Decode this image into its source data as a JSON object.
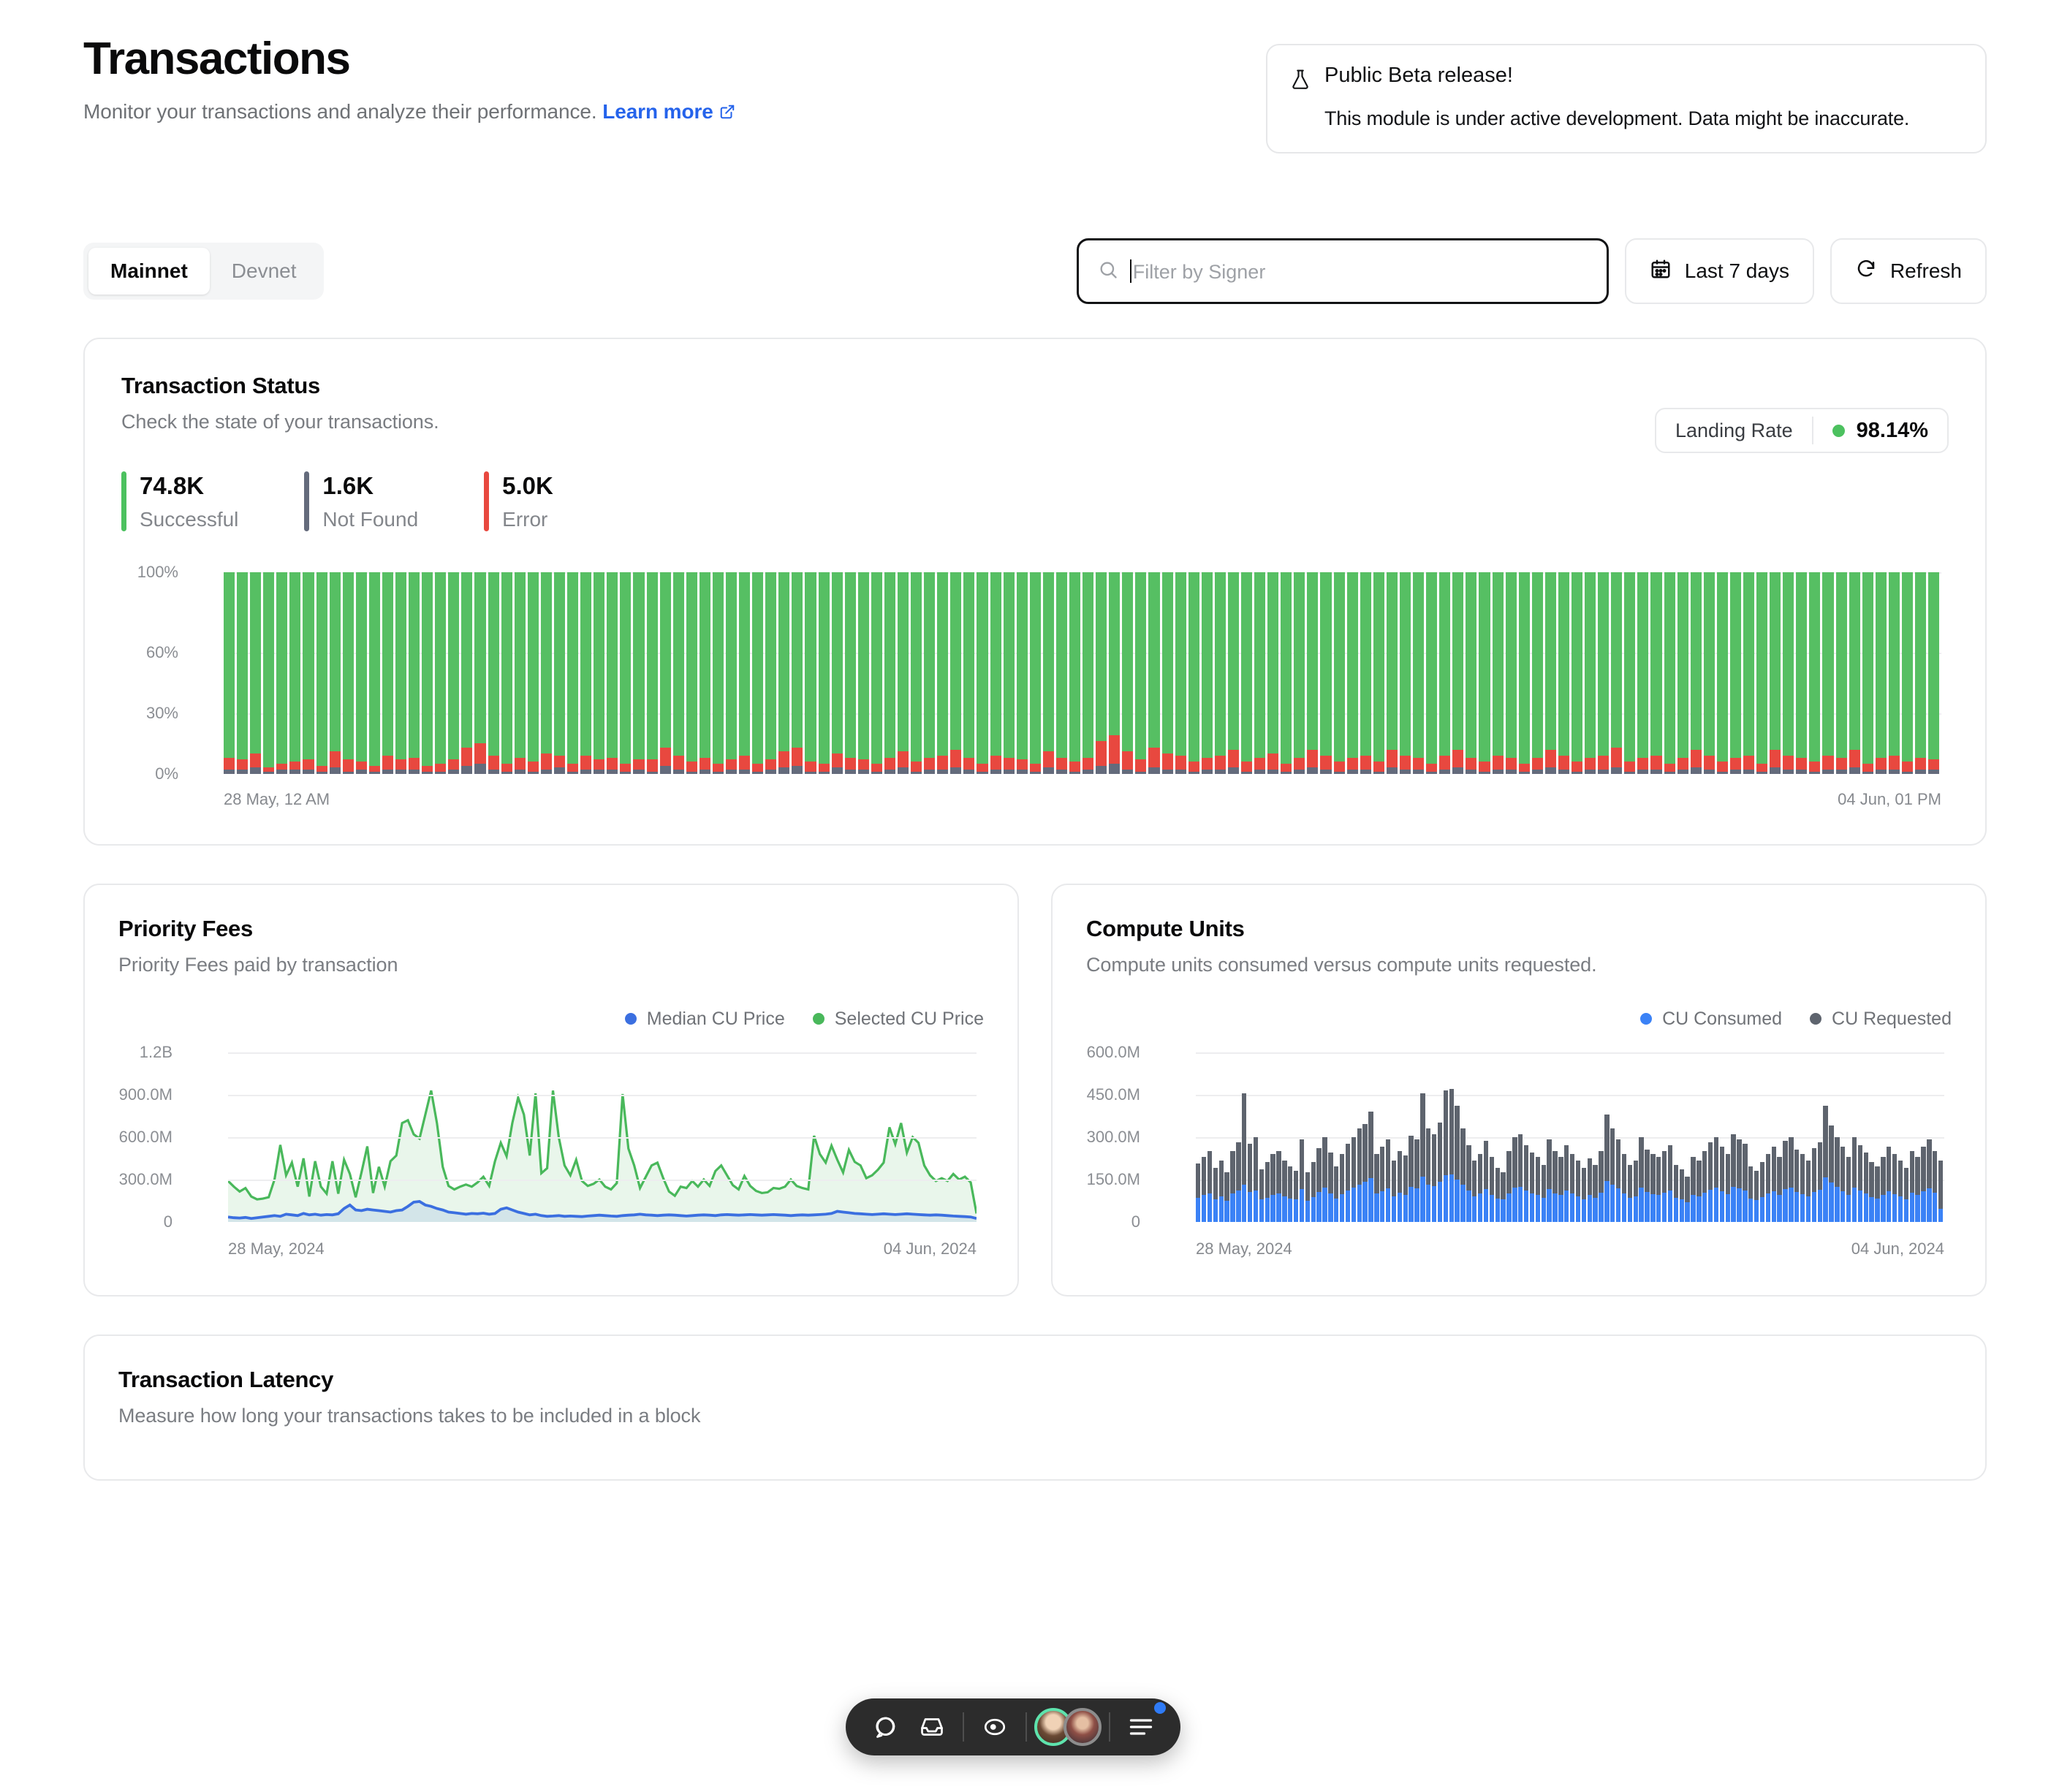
{
  "header": {
    "title": "Transactions",
    "subtitle": "Monitor your transactions and analyze their performance.",
    "learn_more": "Learn more",
    "learn_more_icon": "external-link-icon"
  },
  "beta_notice": {
    "icon": "flask-icon",
    "title": "Public Beta release!",
    "description": "This module is under active development. Data might be inaccurate."
  },
  "toolbar": {
    "network_tabs": [
      {
        "label": "Mainnet",
        "active": true
      },
      {
        "label": "Devnet",
        "active": false
      }
    ],
    "search": {
      "placeholder": "Filter by Signer",
      "value": "",
      "icon": "search-icon"
    },
    "date_range": {
      "label": "Last 7 days",
      "icon": "calendar-icon"
    },
    "refresh": {
      "label": "Refresh",
      "icon": "refresh-icon"
    }
  },
  "transaction_status": {
    "title": "Transaction Status",
    "subtitle": "Check the state of your transactions.",
    "stats": [
      {
        "value": "74.8K",
        "label": "Successful",
        "color": "#4cc15f"
      },
      {
        "value": "1.6K",
        "label": "Not Found",
        "color": "#646b7c"
      },
      {
        "value": "5.0K",
        "label": "Error",
        "color": "#e8483f"
      }
    ],
    "landing_rate": {
      "label": "Landing Rate",
      "value": "98.14%",
      "dot_color": "#4cc15f"
    }
  },
  "priority_fees": {
    "title": "Priority Fees",
    "subtitle": "Priority Fees paid by transaction",
    "legend": [
      {
        "label": "Median CU Price",
        "color": "#3b6fe0"
      },
      {
        "label": "Selected CU Price",
        "color": "#49b85b"
      }
    ]
  },
  "compute_units": {
    "title": "Compute Units",
    "subtitle": "Compute units consumed versus compute units requested.",
    "legend": [
      {
        "label": "CU Consumed",
        "color": "#3b82f6"
      },
      {
        "label": "CU Requested",
        "color": "#5e646e"
      }
    ]
  },
  "transaction_latency": {
    "title": "Transaction Latency",
    "subtitle": "Measure how long your transactions takes to be included in a block"
  },
  "floating_toolbar": {
    "items": [
      {
        "name": "comment-icon"
      },
      {
        "name": "inbox-icon"
      },
      {
        "name": "record-icon"
      },
      {
        "name": "avatar-1"
      },
      {
        "name": "avatar-2"
      },
      {
        "name": "menu-icon",
        "badge": true
      }
    ]
  },
  "chart_data": [
    {
      "id": "transaction_status_chart",
      "type": "bar",
      "stacked": true,
      "title": "Transaction Status",
      "xlabel": "",
      "ylabel": "",
      "ylim": [
        0,
        100
      ],
      "ytick_labels": [
        "100%",
        "60%",
        "30%",
        "0%"
      ],
      "ytick_values": [
        100,
        60,
        30,
        0
      ],
      "grid": true,
      "legend_position": "none",
      "x_axis_start": "28 May, 12 AM",
      "x_axis_end": "04 Jun, 01 PM",
      "series": [
        {
          "name": "Not Found",
          "color": "#646b7c",
          "values": [
            2,
            2,
            3,
            1,
            2,
            2,
            2,
            1,
            3,
            1,
            2,
            1,
            2,
            2,
            2,
            1,
            1,
            2,
            4,
            5,
            2,
            1,
            2,
            1,
            2,
            3,
            1,
            2,
            2,
            2,
            1,
            2,
            1,
            4,
            2,
            1,
            2,
            1,
            2,
            2,
            1,
            2,
            3,
            4,
            1,
            1,
            3,
            2,
            2,
            1,
            2,
            3,
            1,
            2,
            2,
            3,
            2,
            1,
            2,
            2,
            2,
            1,
            3,
            2,
            1,
            2,
            4,
            5,
            2,
            1,
            3,
            2,
            2,
            1,
            2,
            2,
            3,
            1,
            2,
            2,
            1,
            2,
            3,
            2,
            1,
            2,
            2,
            1,
            3,
            2,
            2,
            1,
            2,
            3,
            2,
            1,
            2,
            2,
            1,
            2,
            3,
            2,
            1,
            2,
            2,
            3,
            1,
            2,
            2,
            1,
            2,
            3,
            2,
            1,
            2,
            2,
            1,
            3,
            2,
            2,
            1,
            2,
            2,
            3,
            1,
            2,
            2,
            1,
            2,
            2
          ]
        },
        {
          "name": "Error",
          "color": "#e8483f",
          "values": [
            6,
            5,
            7,
            2,
            3,
            4,
            5,
            3,
            8,
            6,
            4,
            3,
            7,
            5,
            6,
            3,
            4,
            5,
            9,
            10,
            7,
            4,
            6,
            5,
            8,
            6,
            4,
            7,
            5,
            6,
            4,
            5,
            6,
            9,
            7,
            5,
            6,
            4,
            5,
            7,
            4,
            5,
            8,
            9,
            5,
            4,
            7,
            6,
            5,
            4,
            6,
            8,
            5,
            6,
            7,
            9,
            6,
            4,
            7,
            6,
            5,
            4,
            8,
            6,
            5,
            6,
            12,
            14,
            9,
            6,
            10,
            8,
            7,
            5,
            6,
            7,
            9,
            5,
            6,
            8,
            4,
            6,
            9,
            7,
            5,
            6,
            7,
            5,
            9,
            7,
            6,
            4,
            7,
            9,
            6,
            5,
            7,
            6,
            4,
            6,
            9,
            7,
            5,
            6,
            7,
            10,
            5,
            6,
            7,
            4,
            6,
            9,
            7,
            5,
            6,
            7,
            4,
            9,
            7,
            6,
            5,
            7,
            6,
            9,
            4,
            6,
            7,
            5,
            6,
            5
          ]
        },
        {
          "name": "Successful",
          "color": "#56bf63",
          "values": [
            92,
            93,
            90,
            97,
            95,
            94,
            93,
            96,
            89,
            93,
            94,
            96,
            91,
            93,
            92,
            96,
            95,
            93,
            87,
            85,
            91,
            95,
            92,
            94,
            90,
            91,
            95,
            91,
            93,
            92,
            95,
            93,
            93,
            87,
            91,
            94,
            92,
            95,
            93,
            91,
            95,
            93,
            89,
            87,
            94,
            95,
            90,
            92,
            93,
            95,
            92,
            89,
            94,
            92,
            91,
            88,
            92,
            95,
            91,
            92,
            93,
            95,
            89,
            92,
            94,
            92,
            84,
            81,
            89,
            93,
            87,
            90,
            91,
            94,
            92,
            91,
            88,
            94,
            92,
            90,
            95,
            92,
            88,
            91,
            94,
            92,
            91,
            94,
            88,
            91,
            92,
            95,
            91,
            88,
            92,
            94,
            91,
            92,
            95,
            92,
            88,
            91,
            94,
            92,
            91,
            87,
            94,
            92,
            91,
            95,
            92,
            88,
            91,
            94,
            92,
            91,
            95,
            88,
            91,
            92,
            94,
            91,
            92,
            88,
            95,
            92,
            91,
            94,
            92,
            93
          ]
        }
      ]
    },
    {
      "id": "priority_fees_chart",
      "type": "area",
      "title": "Priority Fees",
      "xlabel": "",
      "ylabel": "",
      "ylim": [
        0,
        1200000000
      ],
      "ytick_labels": [
        "1.2B",
        "900.0M",
        "600.0M",
        "300.0M",
        "0"
      ],
      "ytick_values": [
        1200000000,
        900000000,
        600000000,
        300000000,
        0
      ],
      "grid": true,
      "legend_position": "top-right",
      "x_axis_start": "28 May, 2024",
      "x_axis_end": "04 Jun, 2024",
      "series": [
        {
          "name": "Selected CU Price",
          "color": "#49b85b",
          "values": [
            290,
            250,
            215,
            240,
            180,
            160,
            165,
            175,
            300,
            545,
            330,
            420,
            250,
            450,
            180,
            430,
            250,
            200,
            430,
            200,
            440,
            340,
            175,
            350,
            535,
            205,
            390,
            250,
            430,
            470,
            700,
            720,
            620,
            590,
            760,
            930,
            700,
            390,
            255,
            230,
            250,
            265,
            250,
            280,
            320,
            255,
            430,
            560,
            465,
            700,
            880,
            760,
            470,
            910,
            345,
            380,
            930,
            600,
            400,
            330,
            440,
            290,
            255,
            270,
            300,
            250,
            230,
            275,
            905,
            520,
            400,
            240,
            320,
            400,
            420,
            310,
            215,
            185,
            250,
            240,
            290,
            250,
            300,
            255,
            360,
            400,
            330,
            260,
            230,
            325,
            255,
            220,
            205,
            210,
            240,
            235,
            250,
            300,
            255,
            240,
            230,
            610,
            480,
            420,
            540,
            440,
            350,
            510,
            425,
            400,
            310,
            330,
            370,
            420,
            670,
            550,
            700,
            490,
            600,
            560,
            400,
            330,
            290,
            310,
            290,
            340,
            300,
            320,
            280,
            60
          ]
        },
        {
          "name": "Median CU Price",
          "color": "#3b6fe0",
          "values": [
            35,
            30,
            28,
            32,
            25,
            30,
            35,
            40,
            45,
            40,
            55,
            50,
            45,
            60,
            50,
            55,
            48,
            52,
            50,
            58,
            95,
            120,
            85,
            80,
            90,
            85,
            80,
            75,
            70,
            80,
            85,
            110,
            140,
            145,
            120,
            110,
            95,
            85,
            70,
            65,
            60,
            55,
            60,
            58,
            62,
            55,
            60,
            90,
            100,
            85,
            70,
            60,
            50,
            55,
            45,
            40,
            42,
            45,
            40,
            42,
            40,
            38,
            42,
            45,
            48,
            45,
            42,
            40,
            45,
            48,
            50,
            55,
            50,
            48,
            45,
            48,
            50,
            48,
            45,
            42,
            45,
            48,
            50,
            48,
            45,
            50,
            52,
            50,
            48,
            50,
            52,
            50,
            48,
            50,
            52,
            50,
            48,
            45,
            48,
            50,
            48,
            50,
            52,
            55,
            60,
            75,
            70,
            65,
            60,
            58,
            55,
            52,
            55,
            58,
            55,
            52,
            55,
            58,
            55,
            52,
            50,
            48,
            50,
            48,
            45,
            42,
            40,
            38,
            35,
            25
          ]
        }
      ]
    },
    {
      "id": "compute_units_chart",
      "type": "bar",
      "title": "Compute Units",
      "xlabel": "",
      "ylabel": "",
      "ylim": [
        0,
        600000000
      ],
      "ytick_labels": [
        "600.0M",
        "450.0M",
        "300.0M",
        "150.0M",
        "0"
      ],
      "ytick_values": [
        600000000,
        450000000,
        300000000,
        150000000,
        0
      ],
      "grid": true,
      "legend_position": "top-right",
      "x_axis_start": "28 May, 2024",
      "x_axis_end": "04 Jun, 2024",
      "series": [
        {
          "name": "CU Requested",
          "color": "#5e646e",
          "values": [
            205,
            230,
            250,
            190,
            215,
            175,
            250,
            280,
            455,
            275,
            300,
            185,
            210,
            240,
            250,
            215,
            195,
            180,
            290,
            175,
            210,
            260,
            300,
            245,
            195,
            240,
            275,
            300,
            330,
            345,
            390,
            240,
            265,
            290,
            215,
            250,
            235,
            305,
            290,
            455,
            330,
            310,
            350,
            465,
            470,
            410,
            330,
            270,
            215,
            240,
            285,
            230,
            190,
            175,
            250,
            300,
            310,
            270,
            245,
            230,
            200,
            290,
            250,
            230,
            270,
            240,
            215,
            190,
            225,
            200,
            250,
            380,
            330,
            290,
            240,
            200,
            215,
            300,
            255,
            240,
            230,
            250,
            270,
            200,
            185,
            160,
            230,
            215,
            250,
            280,
            300,
            265,
            240,
            310,
            290,
            275,
            195,
            180,
            210,
            240,
            265,
            230,
            285,
            300,
            255,
            240,
            215,
            260,
            280,
            410,
            340,
            300,
            265,
            230,
            300,
            270,
            245,
            210,
            195,
            230,
            265,
            240,
            215,
            190,
            250,
            230,
            265,
            290,
            250,
            215
          ]
        },
        {
          "name": "CU Consumed",
          "color": "#3b82f6",
          "values": [
            85,
            95,
            100,
            80,
            90,
            75,
            100,
            110,
            130,
            105,
            110,
            80,
            85,
            95,
            100,
            90,
            82,
            78,
            115,
            75,
            88,
            105,
            120,
            100,
            82,
            98,
            110,
            120,
            130,
            140,
            155,
            100,
            108,
            118,
            90,
            102,
            95,
            122,
            118,
            160,
            132,
            125,
            140,
            165,
            168,
            150,
            132,
            110,
            90,
            100,
            115,
            95,
            82,
            78,
            100,
            120,
            124,
            110,
            100,
            95,
            85,
            116,
            100,
            95,
            110,
            100,
            90,
            80,
            94,
            85,
            102,
            145,
            132,
            118,
            100,
            85,
            90,
            120,
            104,
            98,
            94,
            102,
            110,
            85,
            78,
            70,
            95,
            90,
            102,
            112,
            120,
            108,
            98,
            124,
            118,
            110,
            82,
            76,
            88,
            100,
            108,
            95,
            116,
            120,
            104,
            98,
            90,
            106,
            112,
            158,
            138,
            122,
            108,
            95,
            120,
            110,
            100,
            88,
            82,
            95,
            108,
            98,
            90,
            80,
            102,
            95,
            108,
            118,
            102,
            45
          ]
        }
      ]
    }
  ]
}
